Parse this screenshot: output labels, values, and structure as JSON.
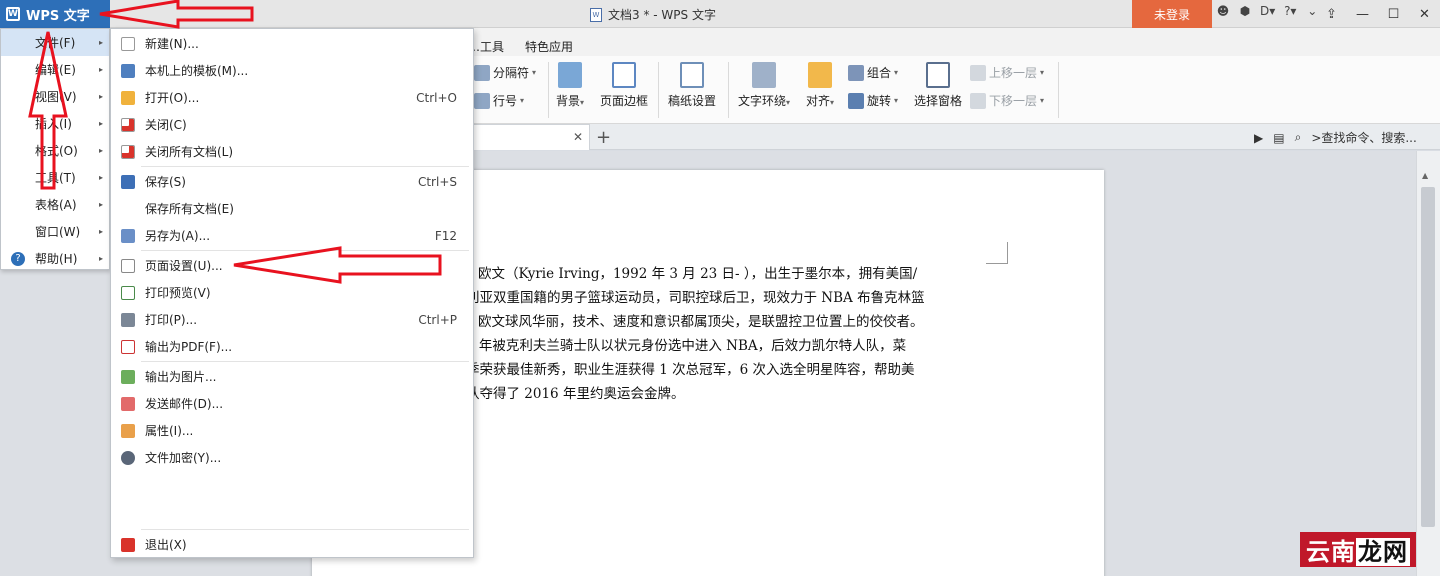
{
  "app": {
    "wps_button": "WPS 文字",
    "doc_title": "文档3 * - WPS 文字",
    "login": "未登录"
  },
  "title_icons": [
    "☻",
    "⬢",
    "D▾",
    "?▾",
    "⌄"
  ],
  "ribbon_tabs": [
    "…工具",
    "特色应用"
  ],
  "ribbon": {
    "separator": "分隔符",
    "line_number": "行号",
    "background": "背景",
    "page_border": "页面边框",
    "paper_setup": "稿纸设置",
    "text_wrap": "文字环绕",
    "align": "对齐",
    "rotate": "旋转",
    "group": "组合",
    "selection_pane": "选择窗格",
    "bring_forward": "上移一层",
    "send_backward": "下移一层"
  },
  "search": {
    "placeholder": ">查找命令、搜索..."
  },
  "main_menu": [
    {
      "label": "文件(F)",
      "arrow": true
    },
    {
      "label": "编辑(E)",
      "arrow": true
    },
    {
      "label": "视图(V)",
      "arrow": true
    },
    {
      "label": "插入(I)",
      "arrow": true
    },
    {
      "label": "格式(O)",
      "arrow": true
    },
    {
      "label": "工具(T)",
      "arrow": true
    },
    {
      "label": "表格(A)",
      "arrow": true
    },
    {
      "label": "窗口(W)",
      "arrow": true
    },
    {
      "label": "帮助(H)",
      "arrow": true
    }
  ],
  "file_menu": [
    {
      "label": "新建(N)...",
      "shortcut": ""
    },
    {
      "label": "本机上的模板(M)...",
      "shortcut": ""
    },
    {
      "label": "打开(O)...",
      "shortcut": "Ctrl+O"
    },
    {
      "label": "关闭(C)",
      "shortcut": ""
    },
    {
      "label": "关闭所有文档(L)",
      "shortcut": ""
    },
    {
      "label": "保存(S)",
      "shortcut": "Ctrl+S"
    },
    {
      "label": "保存所有文档(E)",
      "shortcut": ""
    },
    {
      "label": "另存为(A)...",
      "shortcut": "F12"
    },
    {
      "label": "页面设置(U)...",
      "shortcut": ""
    },
    {
      "label": "打印预览(V)",
      "shortcut": ""
    },
    {
      "label": "打印(P)...",
      "shortcut": "Ctrl+P"
    },
    {
      "label": "输出为PDF(F)...",
      "shortcut": ""
    },
    {
      "label": "输出为图片...",
      "shortcut": ""
    },
    {
      "label": "发送邮件(D)...",
      "shortcut": ""
    },
    {
      "label": "属性(I)...",
      "shortcut": ""
    },
    {
      "label": "文件加密(Y)...",
      "shortcut": ""
    },
    {
      "label": "退出(X)",
      "shortcut": ""
    }
  ],
  "document": {
    "lines": [
      "欧文（Kyrie Irving，1992 年 3 月 23 日- ），出生于墨尔本，拥有美国/",
      "利亚双重国籍的男子篮球运动员，司职控球后卫，现效力于 NBA 布鲁克林篮",
      "欧文球风华丽，技术、速度和意识都属顶尖，是联盟控卫位置上的佼佼者。",
      "1 年被克利夫兰骑士队以状元身份选中进入 NBA，后效力凯尔特人队，菜",
      "季荣获最佳新秀，职业生涯获得 1 次总冠军，6 次入选全明星阵容，帮助美",
      "队夺得了 2016 年里约奥运会金牌。"
    ]
  },
  "watermark": {
    "text_a": "云南",
    "text_b": "龙网"
  },
  "colors": {
    "accent": "#2d6fb8",
    "login": "#e5683e",
    "arrow": "#e8121f"
  }
}
